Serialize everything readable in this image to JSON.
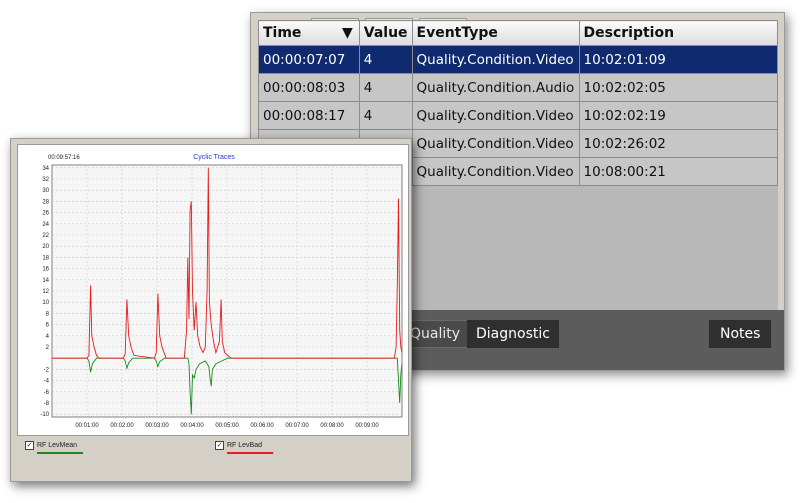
{
  "event_table": {
    "columns": [
      "Time",
      "Value",
      "EventType",
      "Description"
    ],
    "sort_indicator": "▼",
    "rows": [
      {
        "time": "00:00:07:07",
        "value": "4",
        "event_type": "Quality.Condition.Video",
        "description": "10:02:01:09",
        "selected": true
      },
      {
        "time": "00:00:08:03",
        "value": "4",
        "event_type": "Quality.Condition.Audio",
        "description": "10:02:02:05",
        "selected": false
      },
      {
        "time": "00:00:08:17",
        "value": "4",
        "event_type": "Quality.Condition.Video",
        "description": "10:02:02:19",
        "selected": false
      },
      {
        "time": "",
        "value": "",
        "event_type": "Quality.Condition.Video",
        "description": "10:02:26:02",
        "selected": false
      },
      {
        "time": "",
        "value": "",
        "event_type": "Quality.Condition.Video",
        "description": "10:08:00:21",
        "selected": false
      }
    ],
    "tabs": {
      "quality": "Quality",
      "diagnostic": "Diagnostic"
    },
    "notes_button": "Notes"
  },
  "chart_panel": {
    "timestamp": "00:09:57:16",
    "legend": [
      {
        "label": "RF LevMean",
        "checked": true,
        "checkmark": "✓"
      },
      {
        "label": "RF LevBad",
        "checked": true,
        "checkmark": "✓"
      }
    ]
  },
  "colors": {
    "selection": "#0f2a6e",
    "title": "#2b35c9",
    "series_mean": "#1a8a1a",
    "series_bad": "#e81b1b"
  },
  "chart_data": {
    "type": "line",
    "title": "Cyclic Traces",
    "xlabel": "",
    "ylabel": "",
    "x_ticks": [
      "00:01:00",
      "00:02:00",
      "00:03:00",
      "00:04:00",
      "00:05:00",
      "00:06:00",
      "00:07:00",
      "00:08:00",
      "00:09:00"
    ],
    "y_ticks": [
      -10,
      -8,
      -6,
      -4,
      -2,
      2,
      4,
      6,
      8,
      10,
      12,
      14,
      16,
      18,
      20,
      22,
      24,
      26,
      28,
      30,
      32,
      34
    ],
    "xlim": [
      0,
      598
    ],
    "ylim": [
      -10.5,
      34.5
    ],
    "grid": true,
    "legend": "bottom",
    "series": [
      {
        "name": "RF LevMean",
        "color": "#1a8a1a",
        "points": [
          [
            0,
            0
          ],
          [
            60,
            0
          ],
          [
            63,
            -0.5
          ],
          [
            66,
            -2.5
          ],
          [
            69,
            -1
          ],
          [
            76,
            0
          ],
          [
            122,
            0
          ],
          [
            125,
            -0.5
          ],
          [
            128,
            -1.8
          ],
          [
            131,
            -0.8
          ],
          [
            138,
            0
          ],
          [
            175,
            0
          ],
          [
            178,
            -0.5
          ],
          [
            181,
            -1.5
          ],
          [
            184,
            -0.6
          ],
          [
            192,
            0
          ],
          [
            232,
            0
          ],
          [
            234,
            -1
          ],
          [
            236,
            -6
          ],
          [
            238,
            -10
          ],
          [
            240,
            -3
          ],
          [
            243,
            -3.5
          ],
          [
            246,
            -2
          ],
          [
            252,
            -1
          ],
          [
            262,
            -0.5
          ],
          [
            268,
            -1.5
          ],
          [
            270,
            -3.5
          ],
          [
            272,
            -5
          ],
          [
            274,
            -2
          ],
          [
            280,
            -1
          ],
          [
            290,
            -0.5
          ],
          [
            300,
            0
          ],
          [
            590,
            0
          ],
          [
            592,
            -4
          ],
          [
            594,
            -8
          ],
          [
            596,
            -3
          ],
          [
            598,
            -1
          ]
        ]
      },
      {
        "name": "RF LevBad",
        "color": "#e81b1b",
        "points": [
          [
            0,
            0
          ],
          [
            60,
            0
          ],
          [
            63,
            0.5
          ],
          [
            66,
            13
          ],
          [
            68,
            4
          ],
          [
            72,
            2
          ],
          [
            76,
            0.5
          ],
          [
            80,
            0
          ],
          [
            122,
            0
          ],
          [
            125,
            0.8
          ],
          [
            128,
            10.5
          ],
          [
            131,
            4
          ],
          [
            135,
            2
          ],
          [
            140,
            0.5
          ],
          [
            175,
            0
          ],
          [
            178,
            1
          ],
          [
            181,
            11.5
          ],
          [
            184,
            4
          ],
          [
            188,
            2
          ],
          [
            195,
            0
          ],
          [
            226,
            0
          ],
          [
            230,
            5
          ],
          [
            232,
            18
          ],
          [
            234,
            7
          ],
          [
            236,
            26.5
          ],
          [
            238,
            28
          ],
          [
            240,
            12
          ],
          [
            243,
            5
          ],
          [
            246,
            10
          ],
          [
            249,
            4
          ],
          [
            253,
            2
          ],
          [
            258,
            1
          ],
          [
            262,
            2
          ],
          [
            265,
            12
          ],
          [
            267,
            34
          ],
          [
            269,
            10
          ],
          [
            272,
            6
          ],
          [
            276,
            3
          ],
          [
            280,
            1
          ],
          [
            286,
            3
          ],
          [
            289,
            10.5
          ],
          [
            291,
            3
          ],
          [
            295,
            1
          ],
          [
            300,
            0.5
          ],
          [
            306,
            0
          ],
          [
            580,
            0
          ],
          [
            585,
            0
          ],
          [
            588,
            2
          ],
          [
            590,
            13
          ],
          [
            592,
            28.5
          ],
          [
            594,
            5
          ],
          [
            596,
            2
          ],
          [
            598,
            1
          ]
        ]
      }
    ]
  }
}
